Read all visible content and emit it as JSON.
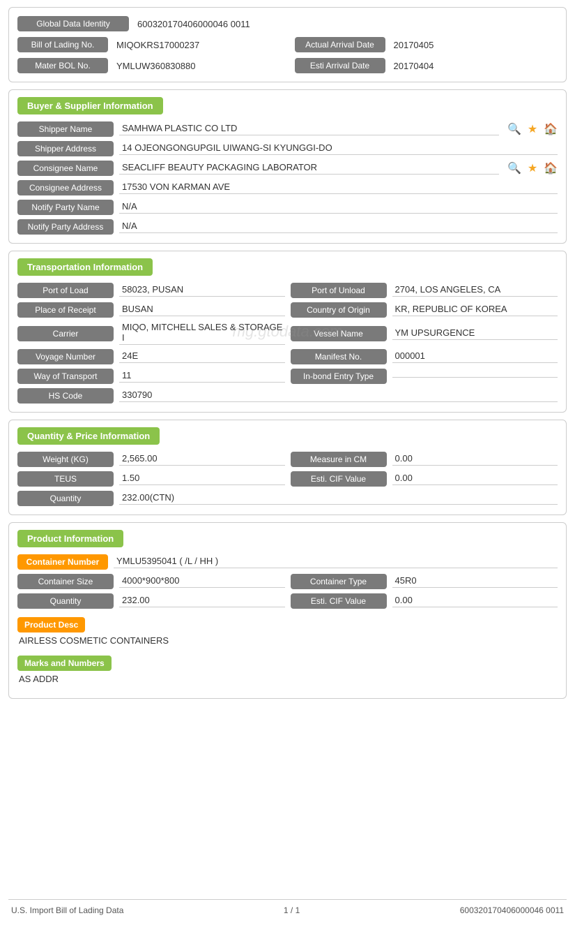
{
  "identity": {
    "global_data_identity_label": "Global Data Identity",
    "global_data_identity_value": "600320170406000046 0011",
    "bill_of_lading_label": "Bill of Lading No.",
    "bill_of_lading_value": "MIQOKRS17000237",
    "actual_arrival_date_label": "Actual Arrival Date",
    "actual_arrival_date_value": "20170405",
    "mater_bol_label": "Mater BOL No.",
    "mater_bol_value": "YMLUW360830880",
    "esti_arrival_date_label": "Esti Arrival Date",
    "esti_arrival_date_value": "20170404"
  },
  "buyer_supplier": {
    "section_title": "Buyer & Supplier Information",
    "shipper_name_label": "Shipper Name",
    "shipper_name_value": "SAMHWA PLASTIC CO LTD",
    "shipper_address_label": "Shipper Address",
    "shipper_address_value": "14 OJEONGONGUPGIL UIWANG-SI KYUNGGI-DO",
    "consignee_name_label": "Consignee Name",
    "consignee_name_value": "SEACLIFF BEAUTY PACKAGING LABORATOR",
    "consignee_address_label": "Consignee Address",
    "consignee_address_value": "17530 VON KARMAN AVE",
    "notify_party_name_label": "Notify Party Name",
    "notify_party_name_value": "N/A",
    "notify_party_address_label": "Notify Party Address",
    "notify_party_address_value": "N/A"
  },
  "transportation": {
    "section_title": "Transportation Information",
    "port_of_load_label": "Port of Load",
    "port_of_load_value": "58023, PUSAN",
    "port_of_unload_label": "Port of Unload",
    "port_of_unload_value": "2704, LOS ANGELES, CA",
    "place_of_receipt_label": "Place of Receipt",
    "place_of_receipt_value": "BUSAN",
    "country_of_origin_label": "Country of Origin",
    "country_of_origin_value": "KR, REPUBLIC OF KOREA",
    "carrier_label": "Carrier",
    "carrier_value": "MIQO, MITCHELL SALES & STORAGE I",
    "vessel_name_label": "Vessel Name",
    "vessel_name_value": "YM UPSURGENCE",
    "voyage_number_label": "Voyage Number",
    "voyage_number_value": "24E",
    "manifest_no_label": "Manifest No.",
    "manifest_no_value": "000001",
    "way_of_transport_label": "Way of Transport",
    "way_of_transport_value": "11",
    "in_bond_entry_type_label": "In-bond Entry Type",
    "in_bond_entry_type_value": "",
    "hs_code_label": "HS Code",
    "hs_code_value": "330790",
    "watermark": "mg.gtodata.com"
  },
  "quantity_price": {
    "section_title": "Quantity & Price Information",
    "weight_kg_label": "Weight (KG)",
    "weight_kg_value": "2,565.00",
    "measure_in_cm_label": "Measure in CM",
    "measure_in_cm_value": "0.00",
    "teus_label": "TEUS",
    "teus_value": "1.50",
    "esti_cif_value_label": "Esti. CIF Value",
    "esti_cif_value": "0.00",
    "quantity_label": "Quantity",
    "quantity_value": "232.00(CTN)"
  },
  "product": {
    "section_title": "Product Information",
    "container_number_label": "Container Number",
    "container_number_value": "YMLU5395041 ( /L / HH )",
    "container_size_label": "Container Size",
    "container_size_value": "4000*900*800",
    "container_type_label": "Container Type",
    "container_type_value": "45R0",
    "quantity_label": "Quantity",
    "quantity_value": "232.00",
    "esti_cif_value_label": "Esti. CIF Value",
    "esti_cif_value": "0.00",
    "product_desc_label": "Product Desc",
    "product_desc_value": "AIRLESS COSMETIC CONTAINERS",
    "marks_and_numbers_label": "Marks and Numbers",
    "marks_and_numbers_value": "AS ADDR"
  },
  "footer": {
    "left": "U.S. Import Bill of Lading Data",
    "center": "1 / 1",
    "right": "600320170406000046 0011"
  }
}
